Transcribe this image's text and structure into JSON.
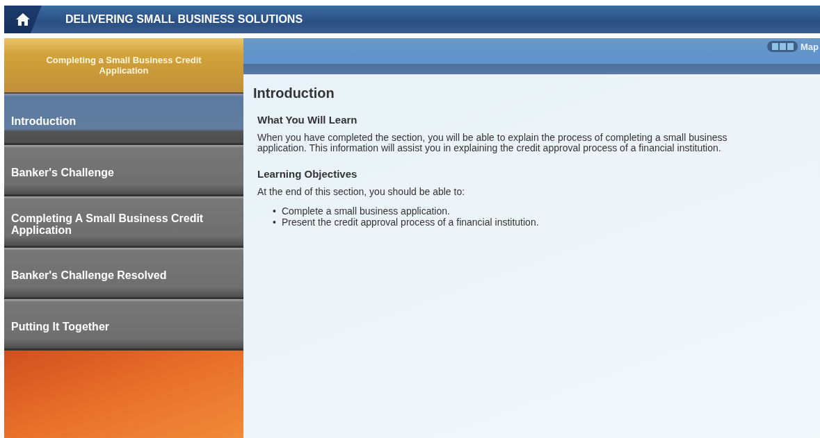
{
  "header": {
    "title": "DELIVERING SMALL BUSINESS SOLUTIONS"
  },
  "sidebar": {
    "title": "Completing a Small Business Credit Application",
    "items": [
      {
        "label": "Introduction",
        "selected": true
      },
      {
        "label": "Banker's Challenge",
        "selected": false
      },
      {
        "label": "Completing A Small Business Credit Application",
        "selected": false
      },
      {
        "label": "Banker's Challenge Resolved",
        "selected": false
      },
      {
        "label": "Putting It Together",
        "selected": false
      }
    ]
  },
  "toolbar": {
    "map_label": "Map"
  },
  "content": {
    "title": "Introduction",
    "sections": [
      {
        "heading": "What You Will Learn",
        "paragraph": "When you have completed the section, you will be able to explain the process of completing a small business application. This information will assist you in explaining the credit approval process of a financial institution."
      },
      {
        "heading": "Learning Objectives",
        "paragraph": "At the end of this section, you should be able to:",
        "bullets": [
          {
            "marker": "•",
            "text": "Complete a small business application."
          },
          {
            "marker": "•",
            "text": "Present the credit approval process of a financial institution."
          }
        ]
      }
    ]
  }
}
